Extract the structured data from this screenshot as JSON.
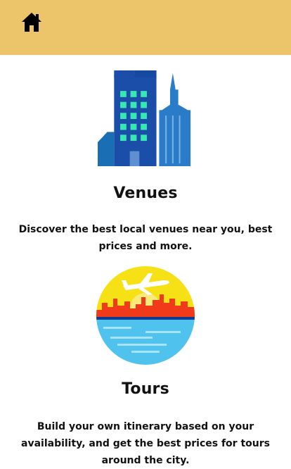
{
  "header": {
    "home_icon": "home-icon",
    "background_color": "#ecc46a"
  },
  "venues": {
    "title": "Venues",
    "description": "Discover the best local venues near you, best prices and more.",
    "illustration": "city-buildings-illustration"
  },
  "tours": {
    "title": "Tours",
    "description": "Build your own itinerary based on your availability, and get the best prices for tours around the city.",
    "illustration": "airplane-city-illustration"
  }
}
